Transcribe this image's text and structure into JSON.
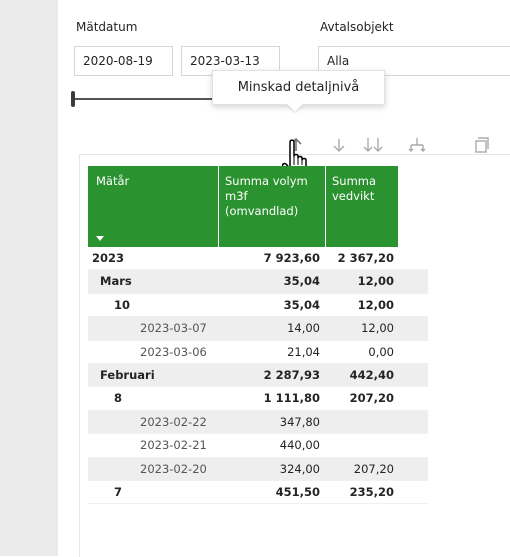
{
  "filters": {
    "matdatum_label": "Mätdatum",
    "avtalsobjekt_label": "Avtalsobjekt",
    "start_date": "2020-08-19",
    "end_date": "2023-03-13",
    "avtalsobjekt_value": "Alla"
  },
  "tooltip": {
    "text": "Minskad detaljnivå"
  },
  "toolbar": {
    "icons": [
      "drill-up-icon",
      "drill-down-icon",
      "expand-next-level-icon",
      "expand-all-icon",
      "focus-mode-icon"
    ]
  },
  "table": {
    "headers": [
      "Mätår",
      "Summa volym m3f (omvandlad)",
      "Summa vedvikt"
    ],
    "rows": [
      {
        "label": "2023",
        "vol": "7 923,60",
        "ved": "2 367,20",
        "level": 0,
        "bold": true
      },
      {
        "label": "Mars",
        "vol": "35,04",
        "ved": "12,00",
        "level": 1,
        "bold": true
      },
      {
        "label": "10",
        "vol": "35,04",
        "ved": "12,00",
        "level": 2,
        "bold": true
      },
      {
        "label": "2023-03-07",
        "vol": "14,00",
        "ved": "12,00",
        "level": 3,
        "bold": false
      },
      {
        "label": "2023-03-06",
        "vol": "21,04",
        "ved": "0,00",
        "level": 3,
        "bold": false
      },
      {
        "label": "Februari",
        "vol": "2 287,93",
        "ved": "442,40",
        "level": 1,
        "bold": true
      },
      {
        "label": "8",
        "vol": "1 111,80",
        "ved": "207,20",
        "level": 2,
        "bold": true
      },
      {
        "label": "2023-02-22",
        "vol": "347,80",
        "ved": "",
        "level": 3,
        "bold": false
      },
      {
        "label": "2023-02-21",
        "vol": "440,00",
        "ved": "",
        "level": 3,
        "bold": false
      },
      {
        "label": "2023-02-20",
        "vol": "324,00",
        "ved": "207,20",
        "level": 3,
        "bold": false
      },
      {
        "label": "7",
        "vol": "451,50",
        "ved": "235,20",
        "level": 2,
        "bold": true
      }
    ]
  },
  "colors": {
    "header_green": "#2b9230",
    "row_shade": "#eeeeee"
  }
}
